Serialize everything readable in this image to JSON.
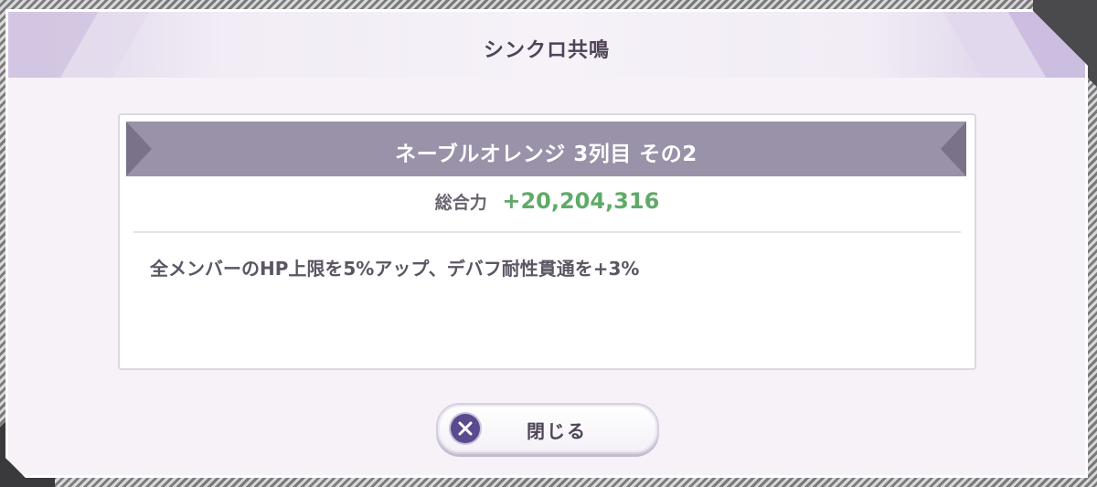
{
  "dialog": {
    "title": "シンクロ共鳴"
  },
  "panel": {
    "title": "ネーブルオレンジ 3列目 その2",
    "stat_label": "総合力",
    "stat_value": "+20,204,316",
    "description": "全メンバーのHP上限を5%アップ、デバフ耐性貫通を+3%"
  },
  "buttons": {
    "close_label": "閉じる"
  },
  "colors": {
    "header_band": "#9a92a9",
    "stat_value": "#5faa68",
    "close_icon_bg": "#5a4a8e"
  },
  "icons": {
    "close": "close-icon"
  }
}
